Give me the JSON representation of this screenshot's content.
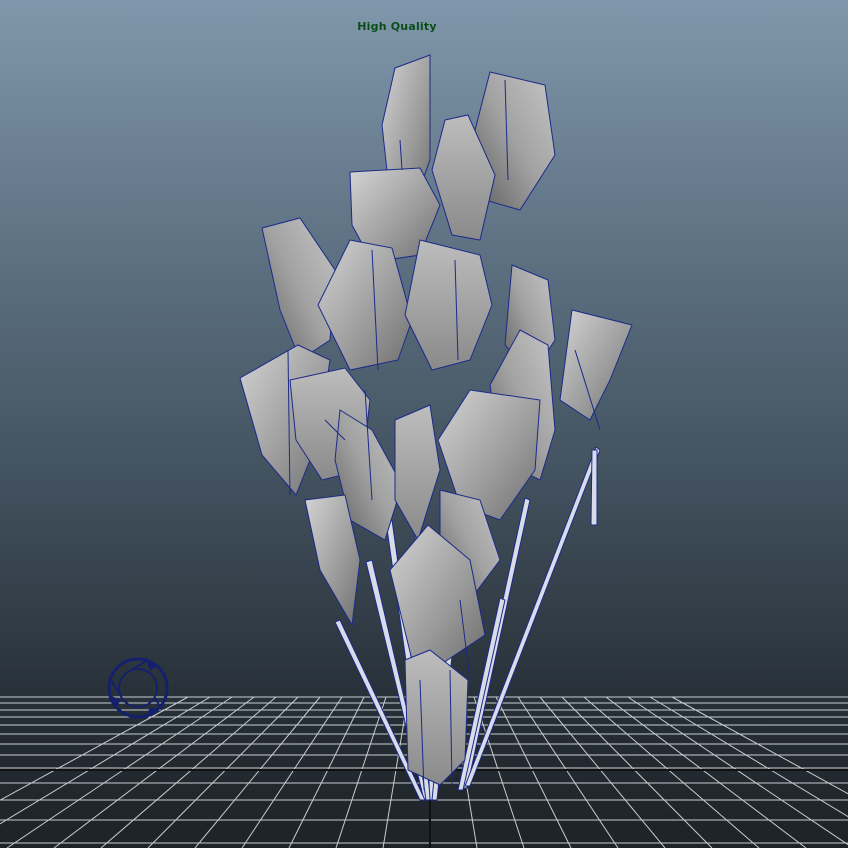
{
  "viewport": {
    "hud_title": "High Quality",
    "hud_bottom_label": "",
    "colors": {
      "hud_text": "#0b4d1a",
      "grid_line": "#e8ecef",
      "leaf_fill": "#a9aaab",
      "wireframe": "#1c2a8a"
    }
  },
  "icons": {
    "view_cube": "view-navigation-icon"
  }
}
